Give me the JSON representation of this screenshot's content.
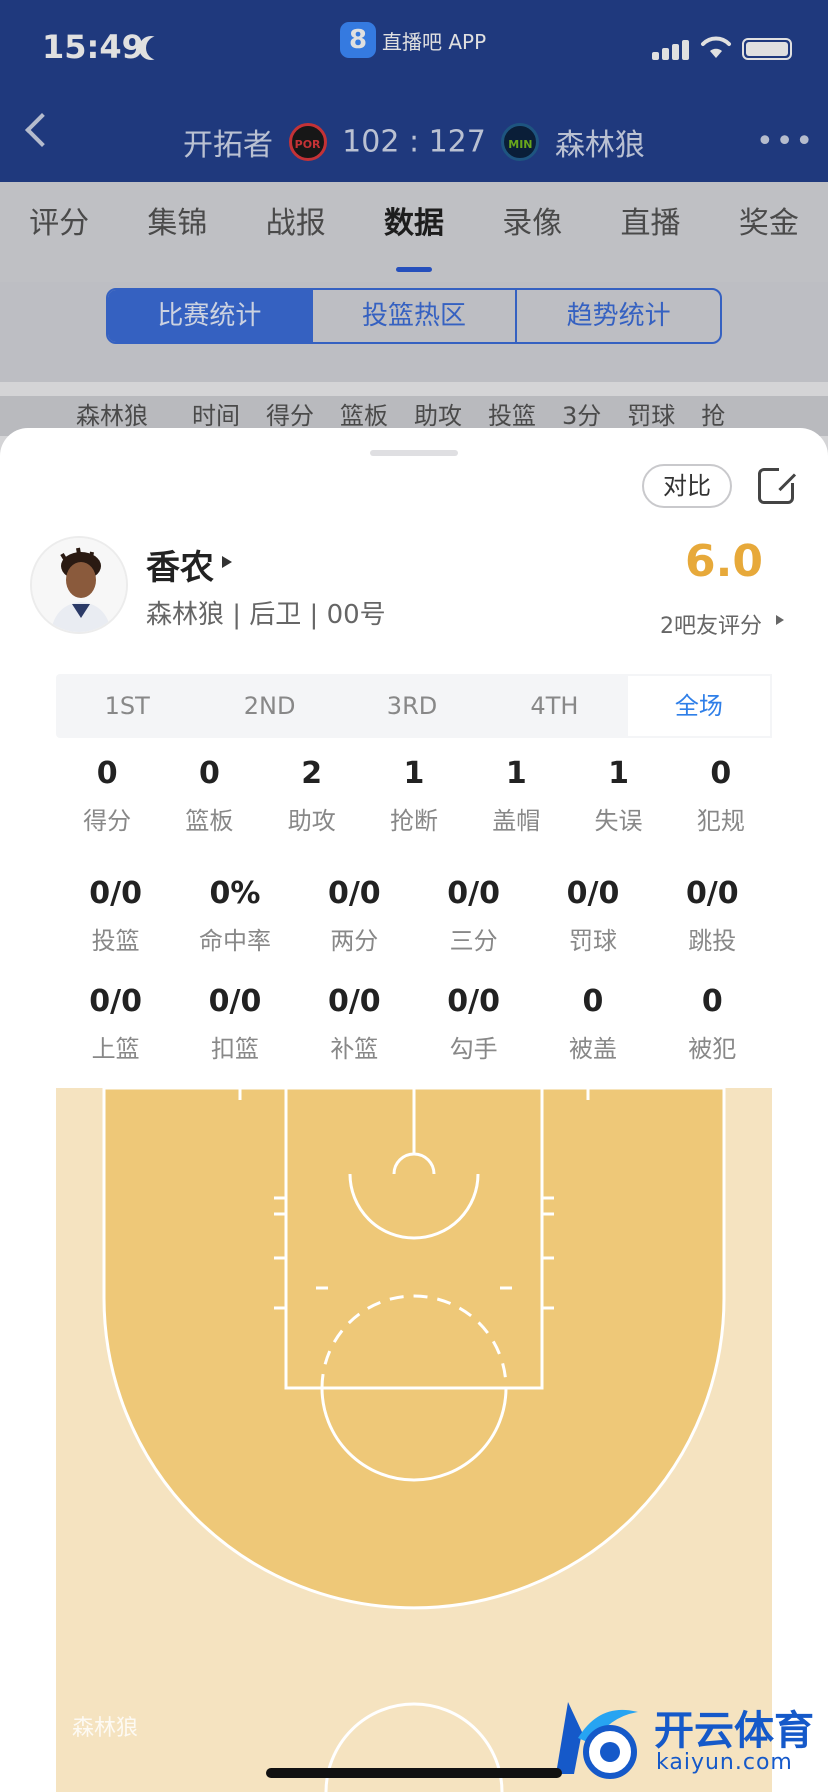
{
  "status_bar": {
    "time": "15:49",
    "app_label": "直播吧 APP",
    "app_badge": "8"
  },
  "header": {
    "home_team": "开拓者",
    "home_abbr": "POR",
    "score": "102 : 127",
    "away_abbr": "MIN",
    "away_team": "森林狼"
  },
  "nav_tabs": [
    "评分",
    "集锦",
    "战报",
    "数据",
    "录像",
    "直播",
    "奖金"
  ],
  "active_tab": "数据",
  "segments": [
    "比赛统计",
    "投篮热区",
    "趋势统计"
  ],
  "table_header": [
    "森林狼",
    "时间",
    "得分",
    "篮板",
    "助攻",
    "投篮",
    "3分",
    "罚球",
    "抢"
  ],
  "sheet": {
    "compare_label": "对比",
    "player": {
      "name": "香农",
      "meta": "森林狼 | 后卫 | 00号"
    },
    "rating": {
      "score": "6.0",
      "count_label": "2吧友评分"
    },
    "periods": [
      "1ST",
      "2ND",
      "3RD",
      "4TH",
      "全场"
    ],
    "active_period": "全场",
    "row1": [
      {
        "value": "0",
        "label": "得分"
      },
      {
        "value": "0",
        "label": "篮板"
      },
      {
        "value": "2",
        "label": "助攻"
      },
      {
        "value": "1",
        "label": "抢断"
      },
      {
        "value": "1",
        "label": "盖帽"
      },
      {
        "value": "1",
        "label": "失误"
      },
      {
        "value": "0",
        "label": "犯规"
      }
    ],
    "row2": [
      {
        "value": "0/0",
        "label": "投篮"
      },
      {
        "value": "0%",
        "label": "命中率"
      },
      {
        "value": "0/0",
        "label": "两分"
      },
      {
        "value": "0/0",
        "label": "三分"
      },
      {
        "value": "0/0",
        "label": "罚球"
      },
      {
        "value": "0/0",
        "label": "跳投"
      }
    ],
    "row3": [
      {
        "value": "0/0",
        "label": "上篮"
      },
      {
        "value": "0/0",
        "label": "扣篮"
      },
      {
        "value": "0/0",
        "label": "补篮"
      },
      {
        "value": "0/0",
        "label": "勾手"
      },
      {
        "value": "0",
        "label": "被盖"
      },
      {
        "value": "0",
        "label": "被犯"
      }
    ]
  },
  "watermark": {
    "brand_cn": "开云体育",
    "brand_url": "kaiyun.com",
    "small_text": "森林狼"
  },
  "colors": {
    "header_bg": "#24418f",
    "accent_blue": "#2f7fe8",
    "rating_gold": "#e7a93a",
    "court_outer": "#f5e3c0",
    "court_inner": "#eec878"
  }
}
